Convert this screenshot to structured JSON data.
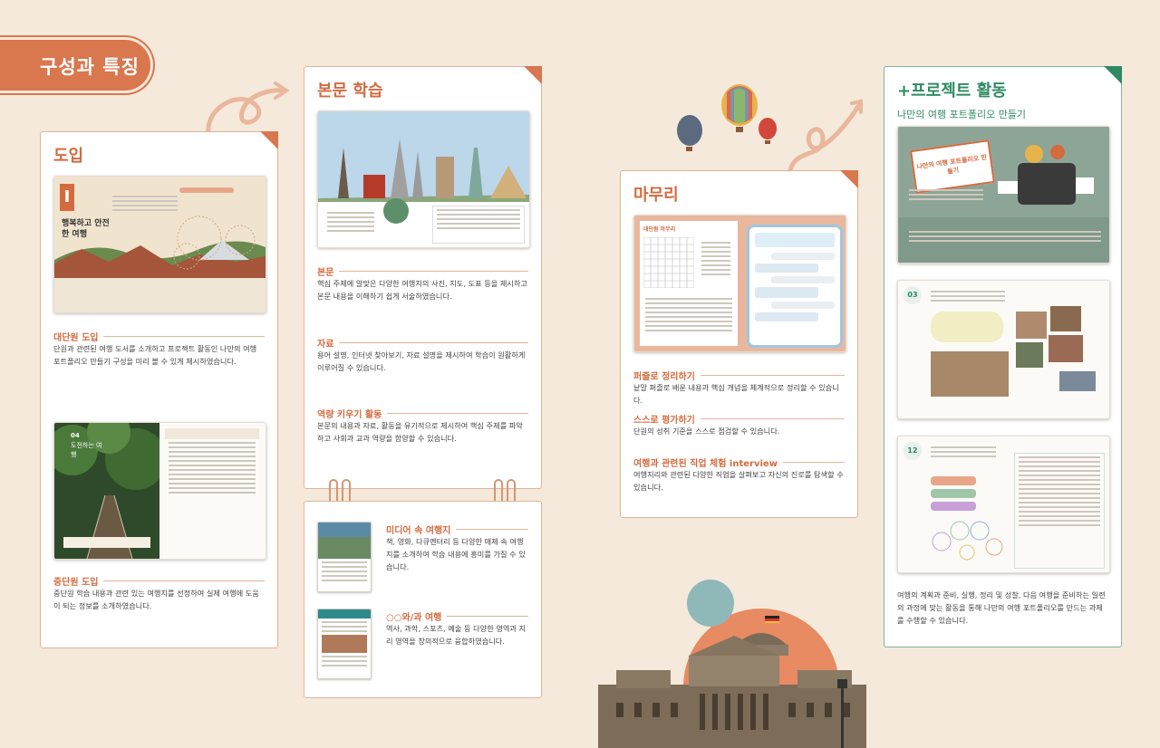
{
  "header": {
    "title": "구성과 특징"
  },
  "intro": {
    "title": "도입",
    "unit_chapter": "I",
    "unit_title": "행복하고 안전한 여행",
    "sub_chapter": "04",
    "sub_title": "도전하는 여행",
    "sections": [
      {
        "heading": "대단원 도입",
        "body": "단원과 관련된 여행 도서를 소개하고 프로젝트 활동인 나만의 여행 포트폴리오 만들기 구성을 미리 볼 수 있게 제시하였습니다."
      },
      {
        "heading": "중단원 도입",
        "body": "중단원 학습 내용과 관련 있는 여행지를 선정하여 실제 여행에 도움이 되는 정보를 소개하였습니다."
      }
    ]
  },
  "main_study": {
    "title": "본문 학습",
    "sections": [
      {
        "heading": "본문",
        "body": "핵심 주제에 알맞은 다양한 여행지의 사진, 지도, 도표 등을 제시하고 본문 내용을 이해하기 쉽게 서술하였습니다."
      },
      {
        "heading": "자료",
        "body": "용어 설명, 인터넷 찾아보기, 자료 설명을 제시하여 학습이 원활하게 이루어질 수 있습니다."
      },
      {
        "heading": "역량 키우기 활동",
        "body": "본문의 내용과 자료, 활동을 유기적으로 제시하여 핵심 주제를 파악하고 사회과 교과 역량을 함양할 수 있습니다."
      }
    ]
  },
  "extras": {
    "sections": [
      {
        "heading": "미디어 속 여행지",
        "body": "책, 영화, 다큐멘터리 등 다양한 매체 속 여행지를 소개하여 학습 내용에 흥미를 가질 수 있습니다."
      },
      {
        "heading": "○○와/과 여행",
        "body": "역사, 과학, 스포츠, 예술 등 다양한 영역과 지리 영역을 창의적으로 융합하였습니다."
      }
    ]
  },
  "wrap_up": {
    "title": "마무리",
    "thumb_label": "대단원 마무리",
    "sections": [
      {
        "heading": "퍼즐로 정리하기",
        "body": "낱말 퍼즐로 배운 내용과 핵심 개념을 체계적으로 정리할 수 있습니다."
      },
      {
        "heading": "스스로 평가하기",
        "body": "단원의 성취 기준을 스스로 점검할 수 있습니다."
      },
      {
        "heading": "여행과 관련된 직업 체험 interview",
        "body": "여행지리와 관련된 다양한 직업을 살펴보고 자신의 진로를 탐색할 수 있습니다."
      }
    ]
  },
  "project": {
    "title": "+프로젝트 활동",
    "subtitle": "나만의 여행 포트폴리오 만들기",
    "banner_text": "나만의 여행 포트폴리오 만들기",
    "step1": "03",
    "step2": "12",
    "body": "여행의 계획과 준비, 실행, 정리 및 성찰, 다음 여행을 준비하는 일련의 과정에 맞는 활동을 통해 나만의 여행 포트폴리오를 만드는 과제를 수행할 수 있습니다."
  },
  "colors": {
    "accent": "#d36b3f",
    "green": "#2f8a63",
    "background": "#f4e9da"
  }
}
